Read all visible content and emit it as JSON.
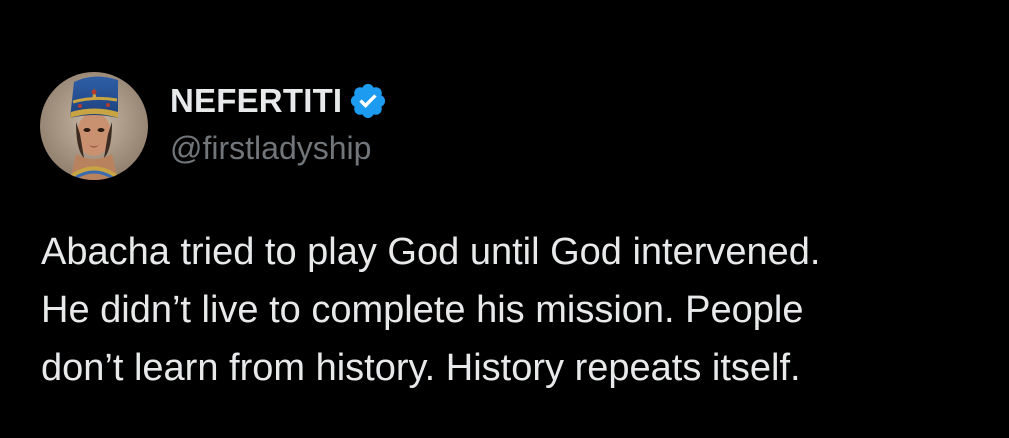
{
  "author": {
    "display_name": "NEFERTITI",
    "handle": "@firstladyship",
    "verified": true,
    "avatar_icon": "nefertiti-bust-avatar"
  },
  "tweet": {
    "text": "Abacha tried to play God until God intervened.\nHe didn’t live to complete his mission. People\ndon’t learn from history. History repeats itself."
  },
  "colors": {
    "background": "#000000",
    "primary_text": "#e7e9ea",
    "secondary_text": "#71767b",
    "verified_badge": "#1d9bf0"
  }
}
